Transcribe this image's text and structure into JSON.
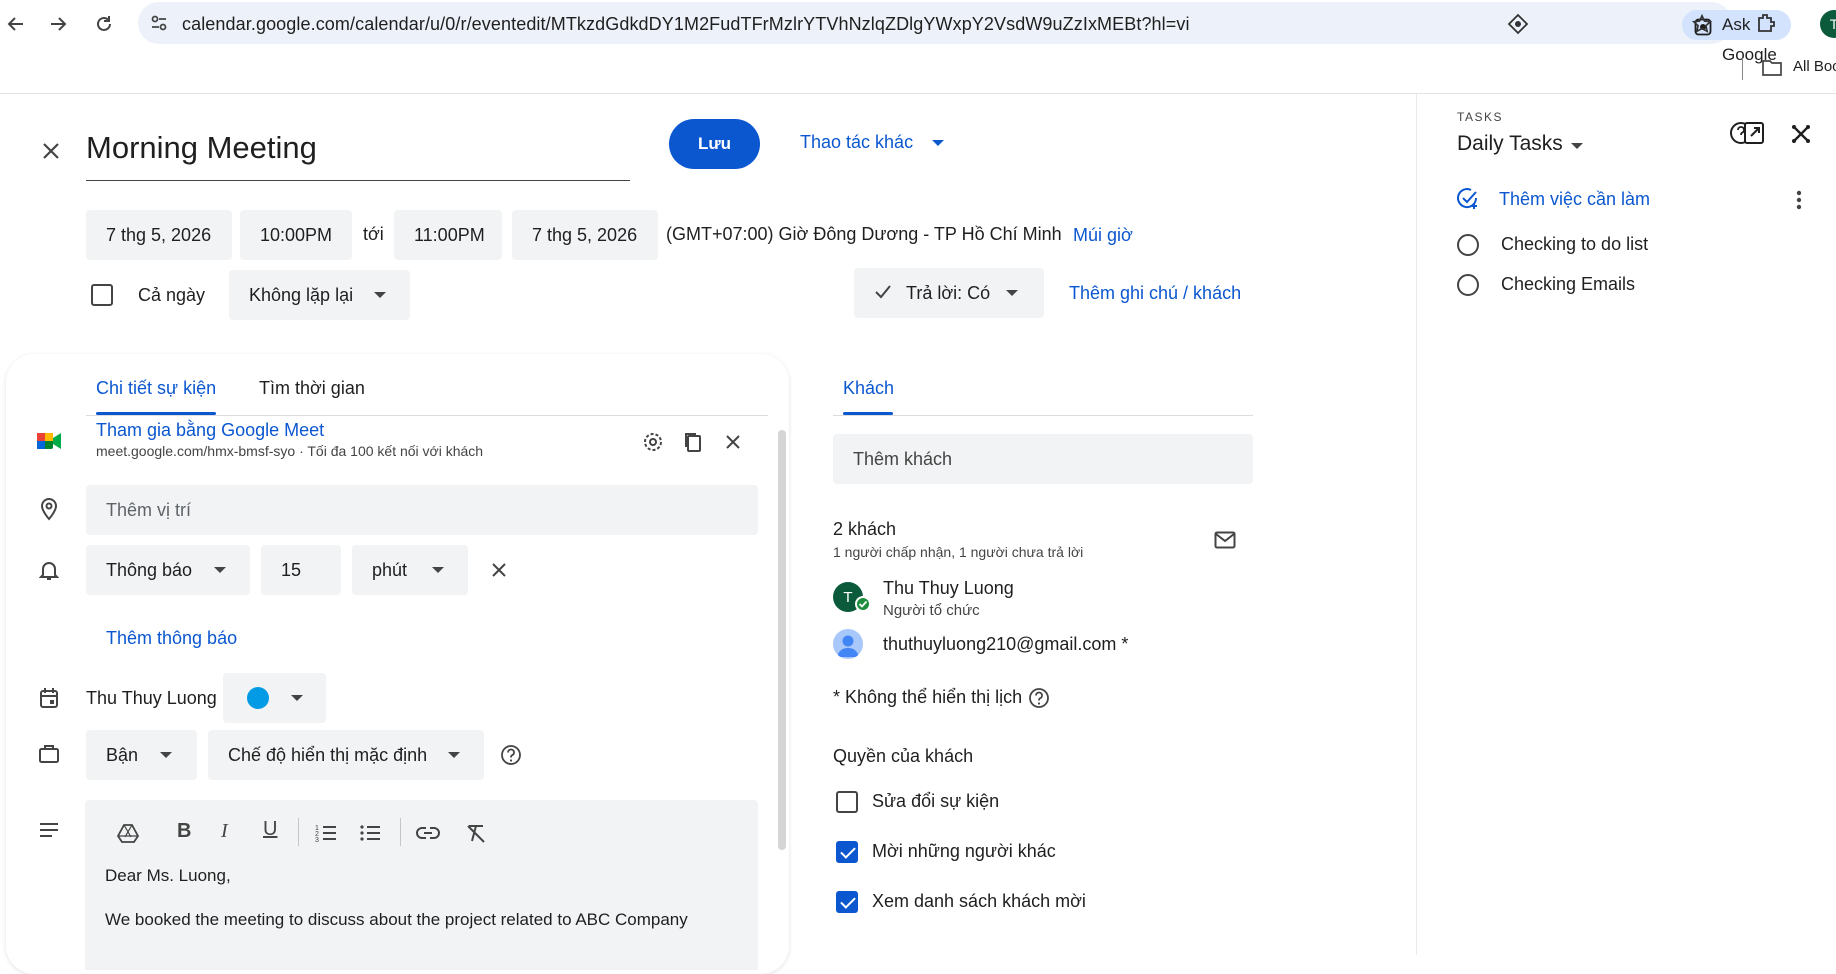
{
  "browser": {
    "url": "calendar.google.com/calendar/u/0/r/eventedit/MTkzdGdkdDY1M2FudTFrMzlrYTVhNzlqZDlgYWxpY2VsdW9uZzIxMEBt?hl=vi",
    "ask_google": "Ask Google",
    "bookmarks_label": "All Boo",
    "profile_initial": "T"
  },
  "event": {
    "title": "Morning Meeting",
    "save_label": "Lưu",
    "more_actions": "Thao tác khác",
    "start_date": "7 thg 5, 2026",
    "start_time": "10:00PM",
    "to_label": "tới",
    "end_time": "11:00PM",
    "end_date": "7 thg 5, 2026",
    "timezone": "(GMT+07:00) Giờ Đông Dương - TP Hồ Chí Minh",
    "timezone_link": "Múi giờ",
    "all_day_label": "Cả ngày",
    "repeat": "Không lặp lại",
    "rsvp": "Trả lời: Có",
    "add_note": "Thêm ghi chú / khách"
  },
  "tabs": {
    "details": "Chi tiết sự kiện",
    "find_time": "Tìm thời gian",
    "guests": "Khách"
  },
  "meet": {
    "join": "Tham gia bằng Google Meet",
    "info": "meet.google.com/hmx-bmsf-syo · Tối đa 100 kết nối với khách"
  },
  "location_placeholder": "Thêm vị trí",
  "notification": {
    "type": "Thông báo",
    "value": "15",
    "unit": "phút",
    "add": "Thêm thông báo"
  },
  "calendar_owner": "Thu Thuy Luong",
  "calendar_color": "#039be5",
  "availability": "Bận",
  "visibility": "Chế độ hiển thị mặc định",
  "description": {
    "line1": "Dear Ms. Luong,",
    "line2": "We booked the meeting to discuss about the project related to ABC Company"
  },
  "guests": {
    "add_placeholder": "Thêm khách",
    "count": "2 khách",
    "summary": "1 người chấp nhận, 1 người chưa trả lời",
    "list": [
      {
        "name": "Thu Thuy Luong",
        "role": "Người tổ chức",
        "initial": "T"
      },
      {
        "name": "thuthuyluong210@gmail.com *",
        "role": ""
      }
    ],
    "note": "* Không thể hiển thị lịch",
    "permissions_title": "Quyền của khách",
    "permissions": [
      {
        "label": "Sửa đổi sự kiện",
        "checked": false
      },
      {
        "label": "Mời những người khác",
        "checked": true
      },
      {
        "label": "Xem danh sách khách mời",
        "checked": true
      }
    ]
  },
  "tasks": {
    "header": "TASKS",
    "list_name": "Daily Tasks",
    "add": "Thêm việc cần làm",
    "items": [
      "Checking to do list",
      "Checking Emails"
    ]
  }
}
